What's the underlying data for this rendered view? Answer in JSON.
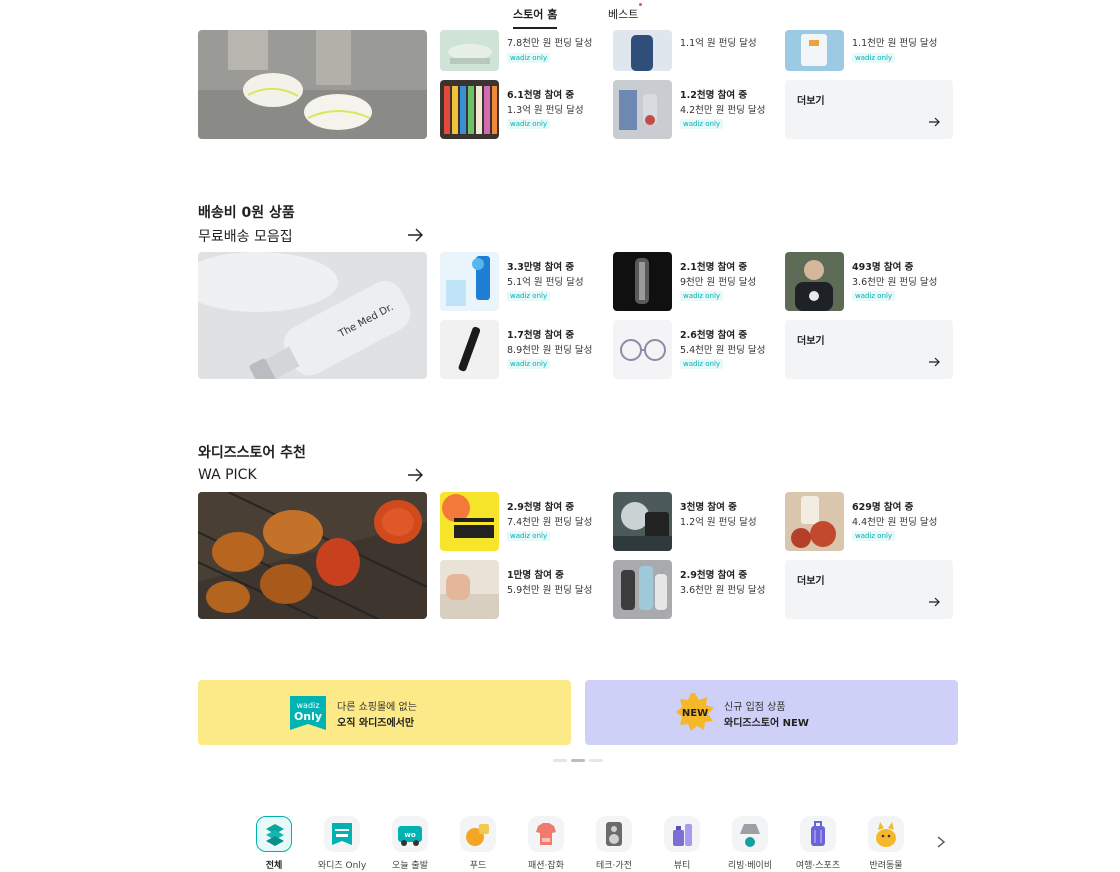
{
  "top_tabs": [
    {
      "label": "스토어 홈",
      "active": true
    },
    {
      "label": "베스트",
      "active": false
    }
  ],
  "sections": [
    {
      "items": [
        {
          "participants": "",
          "amount": "7.8천만 원 펀딩 달성",
          "badge": "wadiz only"
        },
        {
          "participants": "",
          "amount": "1.1억 원 펀딩 달성",
          "badge": ""
        },
        {
          "participants": "",
          "amount": "1.1천만 원 펀딩 달성",
          "badge": "wadiz only"
        },
        {
          "participants": "6.1천명 참여 중",
          "amount": "1.3억 원 펀딩 달성",
          "badge": "wadiz only"
        },
        {
          "participants": "1.2천명 참여 중",
          "amount": "4.2천만 원 펀딩 달성",
          "badge": "wadiz only"
        }
      ],
      "more_label": "더보기"
    },
    {
      "title": "배송비 0원 상품",
      "subtitle": "무료배송 모음집",
      "items": [
        {
          "participants": "3.3만명 참여 중",
          "amount": "5.1억 원 펀딩 달성",
          "badge": "wadiz only"
        },
        {
          "participants": "2.1천명 참여 중",
          "amount": "9천만 원 펀딩 달성",
          "badge": "wadiz only"
        },
        {
          "participants": "493명 참여 중",
          "amount": "3.6천만 원 펀딩 달성",
          "badge": "wadiz only"
        },
        {
          "participants": "1.7천명 참여 중",
          "amount": "8.9천만 원 펀딩 달성",
          "badge": "wadiz only"
        },
        {
          "participants": "2.6천명 참여 중",
          "amount": "5.4천만 원 펀딩 달성",
          "badge": "wadiz only"
        }
      ],
      "more_label": "더보기"
    },
    {
      "title": "와디즈스토어 추천",
      "subtitle": "WA PICK",
      "items": [
        {
          "participants": "2.9천명 참여 중",
          "amount": "7.4천만 원 펀딩 달성",
          "badge": "wadiz only"
        },
        {
          "participants": "3천명 참여 중",
          "amount": "1.2억 원 펀딩 달성",
          "badge": ""
        },
        {
          "participants": "629명 참여 중",
          "amount": "4.4천만 원 펀딩 달성",
          "badge": "wadiz only"
        },
        {
          "participants": "1만명 참여 중",
          "amount": "5.9천만 원 펀딩 달성",
          "badge": ""
        },
        {
          "participants": "2.9천명 참여 중",
          "amount": "3.6천만 원 펀딩 달성",
          "badge": ""
        }
      ],
      "more_label": "더보기"
    }
  ],
  "banners": [
    {
      "icon_text_1": "wadiz",
      "icon_text_2": "Only",
      "line1": "다른 쇼핑몰에 없는",
      "line2": "오직 와디즈에서만",
      "color": "#fbea87"
    },
    {
      "icon_text": "NEW",
      "line1": "신규 입점 상품",
      "line2": "와디즈스토어 NEW",
      "color": "#cfd0f7"
    }
  ],
  "carousel": {
    "count": 3,
    "active": 1
  },
  "categories": [
    {
      "label": "전체",
      "icon": "layers-icon",
      "selected": true
    },
    {
      "label": "와디즈 Only",
      "icon": "wadiz-only-icon",
      "selected": false
    },
    {
      "label": "오늘 출발",
      "icon": "truck-icon",
      "selected": false
    },
    {
      "label": "푸드",
      "icon": "food-icon",
      "selected": false
    },
    {
      "label": "패션·잡화",
      "icon": "fashion-icon",
      "selected": false
    },
    {
      "label": "테크·가전",
      "icon": "speaker-icon",
      "selected": false
    },
    {
      "label": "뷰티",
      "icon": "cosmetics-icon",
      "selected": false
    },
    {
      "label": "리빙·베이비",
      "icon": "lamp-icon",
      "selected": false
    },
    {
      "label": "여행·스포츠",
      "icon": "suitcase-icon",
      "selected": false
    },
    {
      "label": "반려동물",
      "icon": "pet-icon",
      "selected": false
    }
  ],
  "cat_icon_text": "wo",
  "colors": {
    "accent": "#00b2b2",
    "badge_bg": "#e7f9f9",
    "more_bg": "#f2f4f6"
  }
}
